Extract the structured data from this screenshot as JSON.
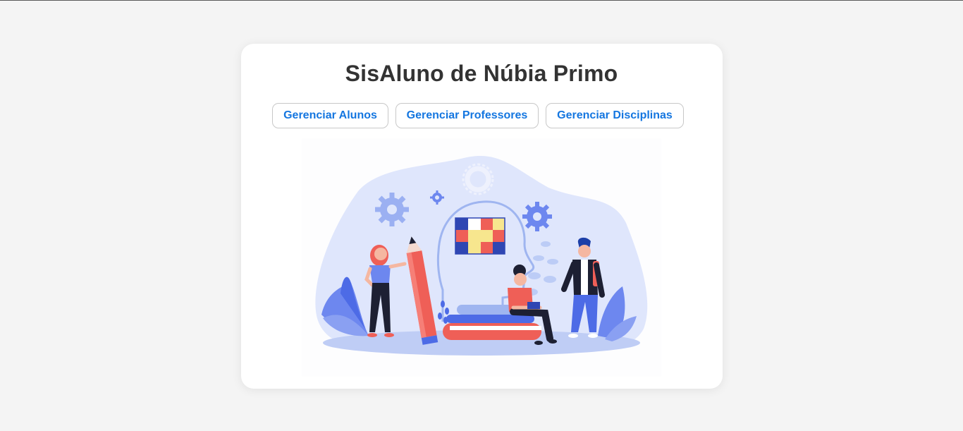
{
  "page": {
    "title": "SisAluno de Núbia Primo"
  },
  "nav": {
    "buttons": [
      {
        "label": "Gerenciar Alunos"
      },
      {
        "label": "Gerenciar Professores"
      },
      {
        "label": "Gerenciar Disciplinas"
      }
    ]
  },
  "illustration": {
    "description_icon": "education-team-illustration"
  },
  "colors": {
    "page_background": "#f4f4f4",
    "card_background": "#ffffff",
    "title_text": "#333333",
    "button_text": "#1476e0",
    "button_border": "#c8c8c8",
    "illustration_blob": "#dfe6fc",
    "illustration_accent": "#ef5f57",
    "illustration_blue": "#6d87ef"
  }
}
